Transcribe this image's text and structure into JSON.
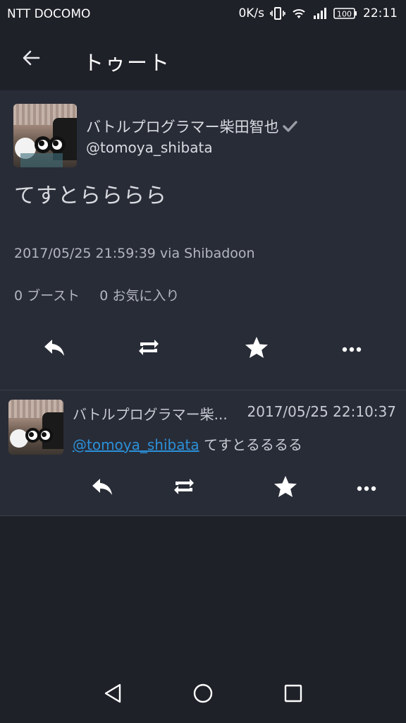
{
  "status_bar": {
    "carrier": "NTT DOCOMO",
    "network_speed": "0K/s",
    "battery": "100",
    "time": "22:11"
  },
  "app_bar": {
    "title": "トゥート",
    "back_icon": "arrow-left-icon"
  },
  "status_detail": {
    "display_name": "バトルプログラマー柴田智也",
    "verified_icon": "checkmark-icon",
    "handle": "@tomoya_shibata",
    "content": "てすとらららら",
    "timestamp_via": "2017/05/25 21:59:39 via Shibadoon",
    "boost_count": "0 ブースト",
    "favourite_count": "0 お気に入り",
    "actions": [
      "reply-icon",
      "boost-icon",
      "favourite-star-icon",
      "more-icon"
    ]
  },
  "reply": {
    "display_name": "バトルプログラマー柴...",
    "timestamp": "2017/05/25 22:10:37",
    "mention": "@tomoya_shibata",
    "content": " てすとるるるる",
    "actions": [
      "reply-icon",
      "boost-icon",
      "favourite-star-icon",
      "more-icon"
    ]
  },
  "nav_bar": {
    "buttons": [
      "back-triangle-icon",
      "home-circle-icon",
      "recents-square-icon"
    ]
  },
  "colors": {
    "background": "#1f2129",
    "card": "#282c37",
    "link": "#2b90d9",
    "text": "#d9dbe0"
  }
}
